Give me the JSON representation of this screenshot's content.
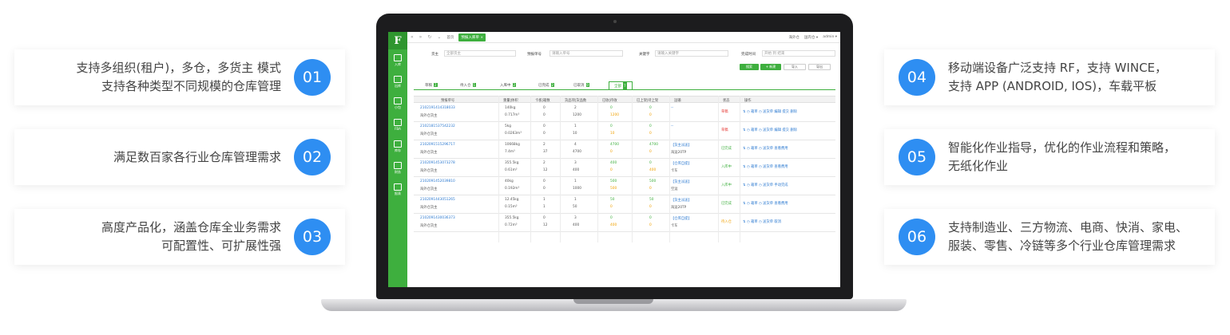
{
  "features": [
    {
      "num": "01",
      "lines": [
        "支持多组织(租户)，多仓，多货主 模式",
        "支持各种类型不同规模的仓库管理"
      ]
    },
    {
      "num": "02",
      "lines": [
        "满足数百家各行业仓库管理需求"
      ]
    },
    {
      "num": "03",
      "lines": [
        "高度产品化，涵盖仓库全业务需求",
        "可配置性、可扩展性强"
      ]
    },
    {
      "num": "04",
      "lines": [
        "移动端设备广泛支持 RF，支持 WINCE，",
        "支持 APP (ANDROID, IOS)，车载平板"
      ]
    },
    {
      "num": "05",
      "lines": [
        "智能化作业指导，优化的作业流程和策略，",
        "无纸化作业"
      ]
    },
    {
      "num": "06",
      "lines": [
        "支持制造业、三方物流、电商、快消、家电、",
        "服装、零售、冷链等多个行业仓库管理需求"
      ]
    }
  ],
  "app": {
    "sidebar": [
      {
        "label": "入库"
      },
      {
        "label": "出库"
      },
      {
        "label": "小包"
      },
      {
        "label": "FBA"
      },
      {
        "label": "库存"
      },
      {
        "label": "财务"
      },
      {
        "label": "报表"
      }
    ],
    "topbar": {
      "home": "首页",
      "active_tab": "预报入库单 ×",
      "right": [
        "海外仓",
        "国内仓 ▾",
        "admin ▾"
      ]
    },
    "filters": {
      "owner_label": "货主",
      "owner_value": "全部货主",
      "order_label": "预报单号",
      "order_placeholder": "请输入单号",
      "keyword_label": "关键字",
      "keyword_placeholder": "请输入关键字",
      "time_label": "完成时间",
      "time_placeholder": "开始 到 结束",
      "search": "搜索",
      "create": "+ 新建",
      "import": "导入",
      "export": "导出"
    },
    "tabs": [
      {
        "label": "草稿",
        "count": "2"
      },
      {
        "label": "待入仓",
        "count": "1"
      },
      {
        "label": "入库中",
        "count": "2"
      },
      {
        "label": "已完成",
        "count": "2"
      },
      {
        "label": "已取消",
        "count": "0"
      },
      {
        "label": "全部",
        "count": "7"
      }
    ],
    "columns": [
      "预报单号",
      "重量|体积",
      "卡板|箱数",
      "货品项|货品数",
      "已收|待收",
      "已上架|待上架",
      "运输",
      "状态",
      "操作"
    ],
    "rows": [
      {
        "id": "2102191414318033",
        "sub": "海外仓货主",
        "w": "140kg",
        "v": "0.717m³",
        "p1": "0",
        "p2": "0",
        "g1": "2",
        "g2": "1200",
        "r1": "0",
        "r2": "1200",
        "s1": "0",
        "s2": "0",
        "t1": "--",
        "t2": "",
        "status": "草稿",
        "sc": "red",
        "ops": "⇅ ◷ 箱单 ◷ 送货单 编辑 提交 删除"
      },
      {
        "id": "2102181537542232",
        "sub": "海外仓货主",
        "w": "5kg",
        "v": "0.0263m³",
        "p1": "0",
        "p2": "0",
        "g1": "1",
        "g2": "10",
        "r1": "0",
        "r2": "10",
        "s1": "0",
        "s2": "0",
        "t1": "--",
        "t2": "",
        "status": "草稿",
        "sc": "red",
        "ops": "⇅ ◷ 箱单 ◷ 送货单 编辑 提交 删除"
      },
      {
        "id": "2102091515296717",
        "sub": "海外仓货主",
        "w": "10668kg",
        "v": "7.4m³",
        "p1": "2",
        "p2": "37",
        "g1": "4",
        "g2": "4700",
        "r1": "4700",
        "r2": "0",
        "s1": "4700",
        "s2": "0",
        "t1": "【货主派送】",
        "t2": "海运20TP",
        "status": "已完成",
        "sc": "green",
        "ops": "⇅ ◷ 箱单 ◷ 送货单 查看费用"
      },
      {
        "id": "2102091453073278",
        "sub": "海外仓货主",
        "w": "355.5kg",
        "v": "0.61m³",
        "p1": "2",
        "p2": "12",
        "g1": "3",
        "g2": "400",
        "r1": "400",
        "r2": "0",
        "s1": "0",
        "s2": "400",
        "t1": "【仓库自提】",
        "t2": "卡车",
        "status": "入库中",
        "sc": "green",
        "ops": "⇅ ◷ 箱单 ◷ 送货单 查看费用"
      },
      {
        "id": "2102091452039810",
        "sub": "海外仓货主",
        "w": "40kg",
        "v": "0.192m³",
        "p1": "0",
        "p2": "0",
        "g1": "1",
        "g2": "1000",
        "r1": "500",
        "r2": "500",
        "s1": "500",
        "s2": "0",
        "t1": "【货主派送】",
        "t2": "空运",
        "status": "入库中",
        "sc": "green",
        "ops": "⇅ ◷ 箱单 ◷ 送货单 手动完成"
      },
      {
        "id": "2102091443051265",
        "sub": "海外仓货主",
        "w": "12.45kg",
        "v": "0.15m³",
        "p1": "1",
        "p2": "1",
        "g1": "1",
        "g2": "50",
        "r1": "50",
        "r2": "0",
        "s1": "50",
        "s2": "0",
        "t1": "【货主派送】",
        "t2": "海运20TP",
        "status": "已完成",
        "sc": "green",
        "ops": "⇅ ◷ 箱单 ◷ 送货单 查看费用"
      },
      {
        "id": "2102091430036373",
        "sub": "海外仓货主",
        "w": "355.5kg",
        "v": "0.72m³",
        "p1": "0",
        "p2": "12",
        "g1": "3",
        "g2": "400",
        "r1": "0",
        "r2": "400",
        "s1": "0",
        "s2": "0",
        "t1": "【仓库自提】",
        "t2": "卡车",
        "status": "待入仓",
        "sc": "orange",
        "ops": "⇅ ◷ 箱单 ◷ 送货单 取消"
      }
    ]
  }
}
